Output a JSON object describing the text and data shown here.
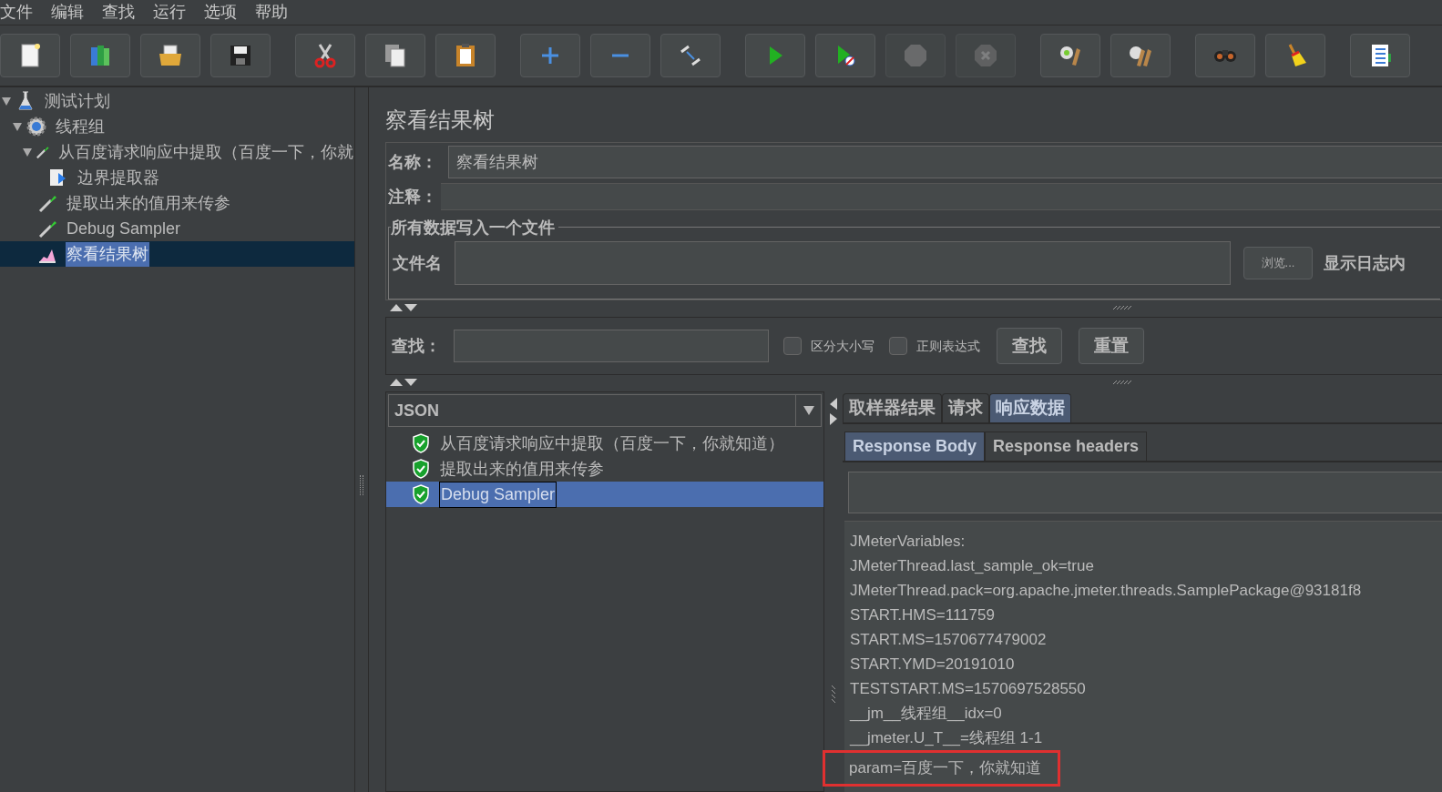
{
  "menu": [
    "文件",
    "编辑",
    "查找",
    "运行",
    "选项",
    "帮助"
  ],
  "toolbar": [
    [
      {
        "kind": "new",
        "disabled": false
      },
      {
        "kind": "templates",
        "disabled": false
      },
      {
        "kind": "open",
        "disabled": false
      },
      {
        "kind": "save",
        "disabled": false
      }
    ],
    [
      {
        "kind": "cut",
        "disabled": false
      },
      {
        "kind": "copy",
        "disabled": false
      },
      {
        "kind": "paste",
        "disabled": false
      }
    ],
    [
      {
        "kind": "expand",
        "disabled": false
      },
      {
        "kind": "collapse",
        "disabled": false
      },
      {
        "kind": "toggle",
        "disabled": false
      }
    ],
    [
      {
        "kind": "start",
        "disabled": false
      },
      {
        "kind": "start-no-pauses",
        "disabled": false
      },
      {
        "kind": "stop",
        "disabled": true
      },
      {
        "kind": "shutdown",
        "disabled": true
      }
    ],
    [
      {
        "kind": "clear",
        "disabled": false
      },
      {
        "kind": "clear-all",
        "disabled": false
      }
    ],
    [
      {
        "kind": "search",
        "disabled": false
      },
      {
        "kind": "reset-search",
        "disabled": false
      }
    ],
    [
      {
        "kind": "function-helper",
        "disabled": false
      }
    ]
  ],
  "tree": [
    {
      "label": "测试计划",
      "kind": "plan",
      "expanded": true,
      "selected": false,
      "children": [
        {
          "label": "线程组",
          "kind": "thread-group",
          "expanded": true,
          "selected": false,
          "children": [
            {
              "label": "从百度请求响应中提取（百度一下，你就",
              "kind": "sampler",
              "expanded": true,
              "selected": false,
              "children": [
                {
                  "label": "边界提取器",
                  "kind": "extractor",
                  "selected": false
                }
              ]
            },
            {
              "label": "提取出来的值用来传参",
              "kind": "sampler",
              "selected": false
            },
            {
              "label": "Debug Sampler",
              "kind": "sampler",
              "selected": false
            },
            {
              "label": "察看结果树",
              "kind": "listener",
              "selected": true
            }
          ]
        }
      ]
    }
  ],
  "panel": {
    "title": "察看结果树",
    "name_label": "名称：",
    "name_value": "察看结果树",
    "comment_label": "注释：",
    "file_group": {
      "legend": "所有数据写入一个文件",
      "file_label": "文件名",
      "browse_button": "浏览...",
      "log_label": "显示日志内"
    },
    "search": {
      "label": "查找：",
      "options": [
        {
          "label": "区分大小写",
          "checked": false
        },
        {
          "label": "正则表达式",
          "checked": false
        }
      ],
      "buttons": [
        "查找",
        "重置"
      ]
    },
    "renderer": {
      "value": "JSON"
    },
    "results": [
      {
        "label": "从百度请求响应中提取（百度一下，你就知道）",
        "selected": false
      },
      {
        "label": "提取出来的值用来传参",
        "selected": false
      },
      {
        "label": "Debug Sampler",
        "selected": true
      }
    ],
    "tabs": [
      {
        "label": "取样器结果",
        "selected": false
      },
      {
        "label": "请求",
        "selected": false
      },
      {
        "label": "响应数据",
        "selected": true
      }
    ],
    "subtabs": [
      {
        "label": "Response Body",
        "selected": true
      },
      {
        "label": "Response headers",
        "selected": false
      }
    ],
    "response_lines": [
      {
        "text": "JMeterVariables:",
        "highlighted": false
      },
      {
        "text": "JMeterThread.last_sample_ok=true",
        "highlighted": false
      },
      {
        "text": "JMeterThread.pack=org.apache.jmeter.threads.SamplePackage@93181f8",
        "highlighted": false
      },
      {
        "text": "START.HMS=111759",
        "highlighted": false
      },
      {
        "text": "START.MS=1570677479002",
        "highlighted": false
      },
      {
        "text": "START.YMD=20191010",
        "highlighted": false
      },
      {
        "text": "TESTSTART.MS=1570697528550",
        "highlighted": false
      },
      {
        "text": "__jm__线程组__idx=0",
        "highlighted": false
      },
      {
        "text": "__jmeter.U_T__=线程组 1-1",
        "highlighted": false
      },
      {
        "text": "param=百度一下，你就知道",
        "highlighted": true
      }
    ]
  }
}
